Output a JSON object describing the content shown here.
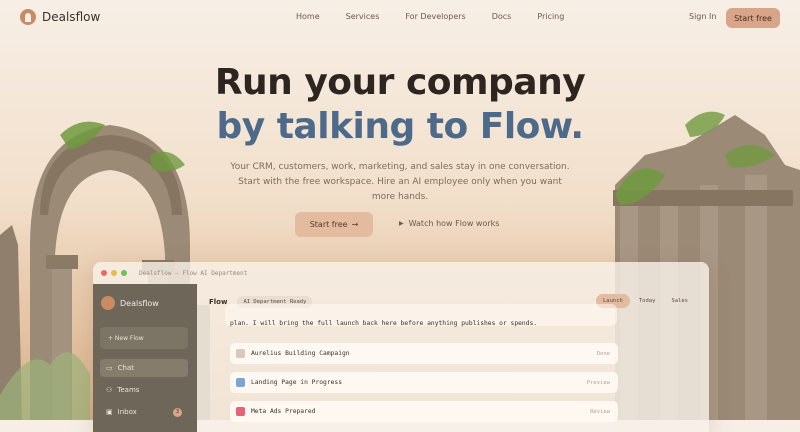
{
  "nav": {
    "brand": "Dealsflow",
    "links": [
      "Home",
      "Services",
      "For Developers",
      "Docs",
      "Pricing"
    ],
    "signin": "Sign In",
    "start": "Start free"
  },
  "hero": {
    "line1": "Run your company",
    "line2": "by talking to Flow.",
    "subtitle": "Your CRM, customers, work, marketing, and sales stay in one conversation. Start with the free workspace. Hire an AI employee only when you want more hands.",
    "cta_primary": "Start free",
    "cta_primary_icon": "arrow-right-icon",
    "cta_secondary": "Watch how Flow works",
    "cta_secondary_icon": "play-icon"
  },
  "app": {
    "window_title": "Dealsflow – Flow AI Department",
    "sidebar": {
      "brand": "Dealsflow",
      "new_flow": "+ New Flow",
      "items": [
        {
          "label": "Chat",
          "icon": "chat-icon",
          "active": true
        },
        {
          "label": "Teams",
          "icon": "people-icon",
          "active": false
        },
        {
          "label": "Inbox",
          "icon": "inbox-icon",
          "active": false,
          "badge": "3"
        }
      ]
    },
    "header": {
      "title": "Flow",
      "chip": "AI Department Ready",
      "segments": [
        "Launch",
        "Today",
        "Sales"
      ],
      "active_segment": "Launch"
    },
    "message": "plan. I will bring the full launch back here before anything publishes or spends.",
    "tasks": [
      {
        "title": "Aurelius Building Campaign",
        "status": "Done",
        "icon_color": "#d9c9bb"
      },
      {
        "title": "Landing Page in Progress",
        "status": "Preview",
        "icon_color": "#7aa6d6"
      },
      {
        "title": "Meta Ads Prepared",
        "status": "Review",
        "icon_color": "#e5627a"
      }
    ]
  },
  "colors": {
    "accent": "#d8a58a",
    "title_blue": "#4d6a8a",
    "sidebar": "#6e6658"
  }
}
